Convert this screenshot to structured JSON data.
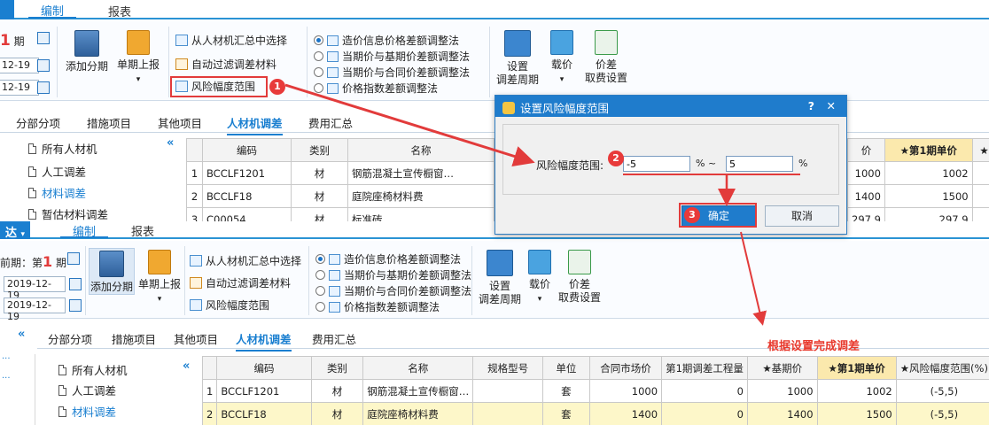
{
  "top": {
    "menu": {
      "tab_edit": "编制",
      "tab_report": "报表"
    },
    "period": {
      "label": "1",
      "label_suffix": "期",
      "date1": "12-19",
      "date2": "12-19"
    },
    "ribbon": {
      "add_period": "添加分期",
      "single_report": "单期上报",
      "opt_select_summary": "从人材机汇总中选择",
      "opt_auto_filter": "自动过滤调差材料",
      "opt_risk_range": "风险幅度范围",
      "radio1": "造价信息价格差额调整法",
      "radio2": "当期价与基期价差额调整法",
      "radio3": "当期价与合同价差额调整法",
      "radio4": "价格指数差额调整法",
      "set_period_l1": "设置",
      "set_period_l2": "调差周期",
      "load_price": "载价",
      "diff_fee_l1": "价差",
      "diff_fee_l2": "取费设置"
    },
    "subtabs": [
      "分部分项",
      "措施项目",
      "其他项目",
      "人材机调差",
      "费用汇总"
    ],
    "tree": [
      "所有人材机",
      "人工调差",
      "材料调差",
      "暂估材料调差"
    ],
    "table": {
      "headers": [
        "编码",
        "类别",
        "名称"
      ],
      "rows": [
        {
          "no": "1",
          "code": "BCCLF1201",
          "cat": "材",
          "name": "钢筋混凝土宣传橱窗…"
        },
        {
          "no": "2",
          "code": "BCCLF18",
          "cat": "材",
          "name": "庭院座椅材料费"
        },
        {
          "no": "3",
          "code": "C00054",
          "cat": "材",
          "name": "标准砖"
        }
      ],
      "right_headers": [
        "价",
        "★第1期单价",
        "★风"
      ],
      "right_rows": [
        [
          "1000",
          "1002"
        ],
        [
          "1400",
          "1500"
        ],
        [
          "297.9",
          "297.9"
        ]
      ]
    }
  },
  "dialog": {
    "title": "设置风险幅度范围",
    "help": "?",
    "close": "✕",
    "label": "风险幅度范围:",
    "min": "-5",
    "sep": "% ~",
    "max": "5",
    "unit": "%",
    "ok": "确定",
    "cancel": "取消"
  },
  "badges": [
    "1",
    "2",
    "3"
  ],
  "note": "根据设置完成调差",
  "bottom": {
    "brand": "达",
    "menu": {
      "tab_edit": "编制",
      "tab_report": "报表"
    },
    "period": {
      "label_prefix": "前期：第",
      "label_num": "1",
      "label_suffix": "期",
      "date1": "2019-12-19",
      "date2": "2019-12-19"
    },
    "ribbon": {
      "add_period": "添加分期",
      "single_report": "单期上报",
      "opt_select_summary": "从人材机汇总中选择",
      "opt_auto_filter": "自动过滤调差材料",
      "opt_risk_range": "风险幅度范围",
      "radio1": "造价信息价格差额调整法",
      "radio2": "当期价与基期价差额调整法",
      "radio3": "当期价与合同价差额调整法",
      "radio4": "价格指数差额调整法",
      "set_period_l1": "设置",
      "set_period_l2": "调差周期",
      "load_price": "载价",
      "diff_fee_l1": "价差",
      "diff_fee_l2": "取费设置"
    },
    "subtabs": [
      "分部分项",
      "措施项目",
      "其他项目",
      "人材机调差",
      "费用汇总"
    ],
    "tree": [
      "所有人材机",
      "人工调差",
      "材料调差"
    ],
    "table": {
      "headers": [
        "编码",
        "类别",
        "名称",
        "规格型号",
        "单位",
        "合同市场价",
        "第1期调差工程量",
        "★基期价",
        "★第1期单价",
        "★风险幅度范围(%)"
      ],
      "rows": [
        {
          "no": "1",
          "code": "BCCLF1201",
          "cat": "材",
          "name": "钢筋混凝土宣传橱窗…",
          "spec": "",
          "unit": "套",
          "market": "1000",
          "qty": "0",
          "base": "1000",
          "price": "1002",
          "risk": "(-5,5)"
        },
        {
          "no": "2",
          "code": "BCCLF18",
          "cat": "材",
          "name": "庭院座椅材料费",
          "spec": "",
          "unit": "套",
          "market": "1400",
          "qty": "0",
          "base": "1400",
          "price": "1500",
          "risk": "(-5,5)"
        }
      ]
    }
  },
  "colors": {
    "accent": "#1a7fd0",
    "highlight_header": "#fbe9ad",
    "annotation_red": "#e23b3b"
  }
}
